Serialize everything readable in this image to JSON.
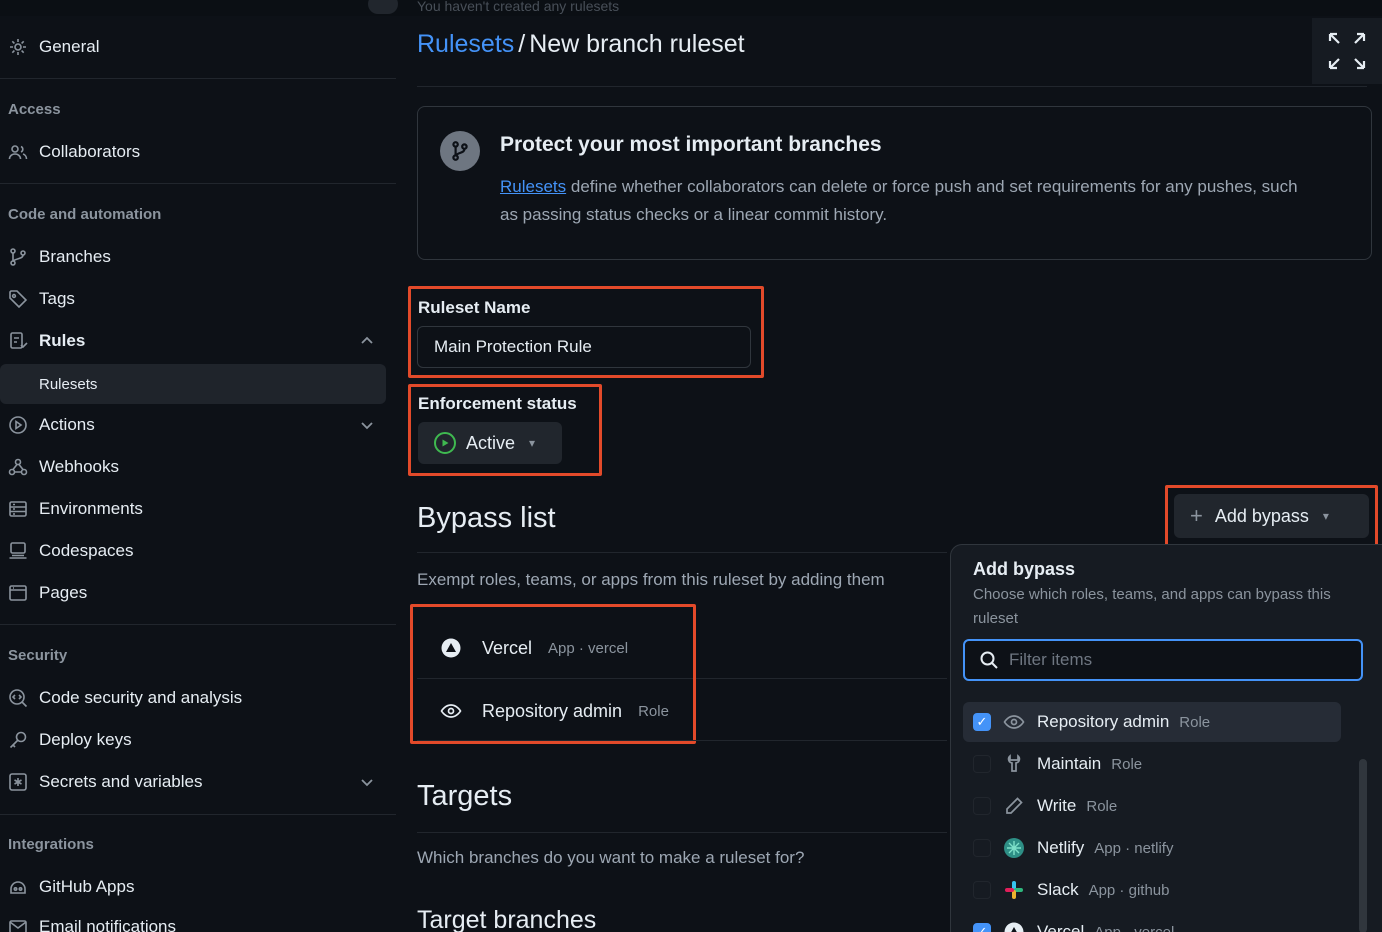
{
  "top_hint": "You haven't created any rulesets",
  "sidebar": {
    "general": "General",
    "sections": {
      "access": "Access",
      "code_automation": "Code and automation",
      "security": "Security",
      "integrations": "Integrations"
    },
    "items": {
      "collaborators": "Collaborators",
      "branches": "Branches",
      "tags": "Tags",
      "rules": "Rules",
      "rulesets": "Rulesets",
      "actions": "Actions",
      "webhooks": "Webhooks",
      "environments": "Environments",
      "codespaces": "Codespaces",
      "pages": "Pages",
      "code_security": "Code security and analysis",
      "deploy_keys": "Deploy keys",
      "secrets": "Secrets and variables",
      "github_apps": "GitHub Apps",
      "email_notifications": "Email notifications"
    }
  },
  "breadcrumb": {
    "parent": "Rulesets",
    "separator": "/",
    "current": "New branch ruleset"
  },
  "info": {
    "title": "Protect your most important branches",
    "link": "Rulesets",
    "body": " define whether collaborators can delete or force push and set requirements for any pushes, such as passing status checks or a linear commit history."
  },
  "form": {
    "name_label": "Ruleset Name",
    "name_value": "Main Protection Rule",
    "enforcement_label": "Enforcement status",
    "enforcement_value": "Active"
  },
  "bypass": {
    "heading": "Bypass list",
    "description": "Exempt roles, teams, or apps from this ruleset by adding them",
    "add_button": "Add bypass",
    "entries": [
      {
        "name": "Vercel",
        "meta": "App · vercel",
        "icon": "vercel-icon"
      },
      {
        "name": "Repository admin",
        "meta": "Role",
        "icon": "eye-icon"
      }
    ]
  },
  "targets": {
    "heading": "Targets",
    "description": "Which branches do you want to make a ruleset for?",
    "sub_heading": "Target branches"
  },
  "panel": {
    "title": "Add bypass",
    "description": "Choose which roles, teams, and apps can bypass this ruleset",
    "filter_placeholder": "Filter items",
    "options": [
      {
        "name": "Repository admin",
        "meta": "Role",
        "checked": true,
        "icon": "eye-icon"
      },
      {
        "name": "Maintain",
        "meta": "Role",
        "checked": false,
        "icon": "tool-icon"
      },
      {
        "name": "Write",
        "meta": "Role",
        "checked": false,
        "icon": "pencil-icon"
      },
      {
        "name": "Netlify",
        "meta": "App · netlify",
        "checked": false,
        "icon": "netlify-icon"
      },
      {
        "name": "Slack",
        "meta": "App · github",
        "checked": false,
        "icon": "slack-icon"
      },
      {
        "name": "Vercel",
        "meta": "App · vercel",
        "checked": true,
        "icon": "vercel-icon"
      }
    ]
  },
  "colors": {
    "accent": "#4493f8",
    "highlight": "#e24a2a",
    "active": "#3fb950",
    "background": "#0d1117"
  }
}
